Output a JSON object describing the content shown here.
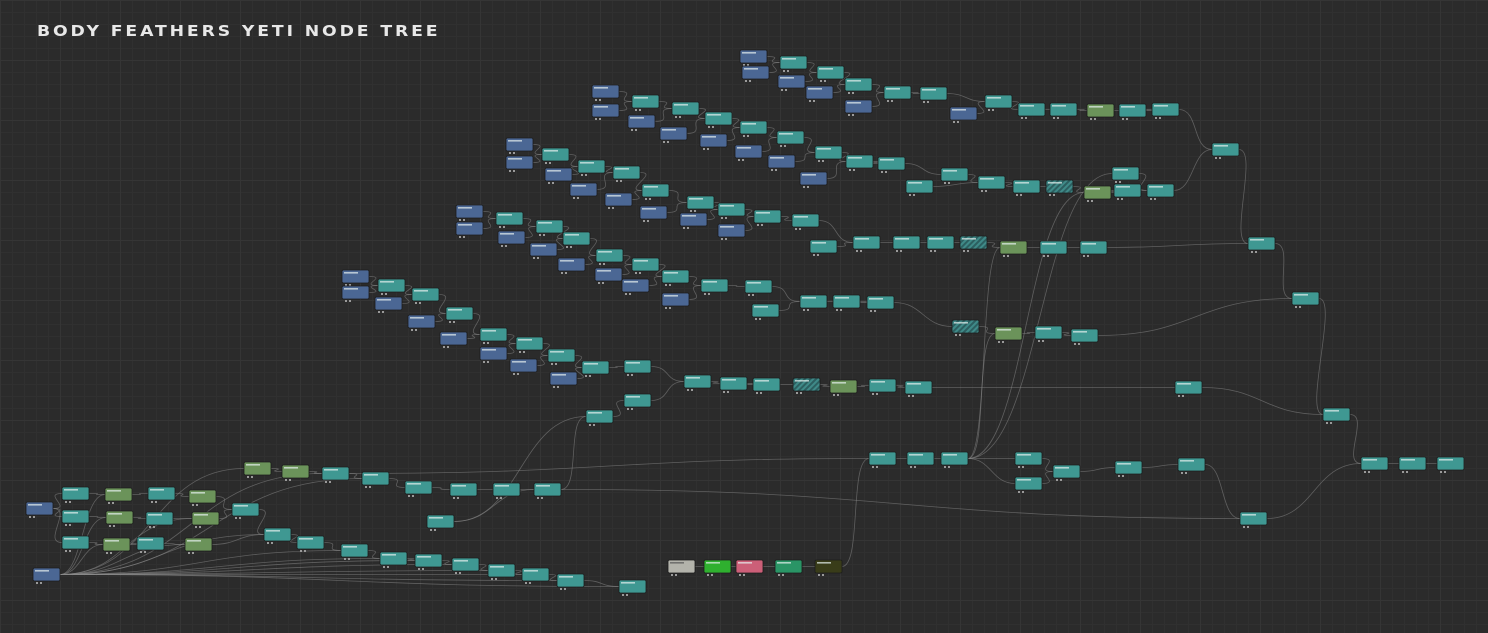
{
  "title": "BODY FEATHERS YETI NODE TREE",
  "node_colors": {
    "t": "#3f9892",
    "b": "#4b6794",
    "g": "#6b935a",
    "h": "#3f8a88",
    "gray": "#b3b3ab",
    "lime": "#2fb02f",
    "pink": "#cc5f78",
    "dgreen": "#2a9566",
    "olive": "#393c19"
  },
  "edge_color": "#8a8a8a"
}
